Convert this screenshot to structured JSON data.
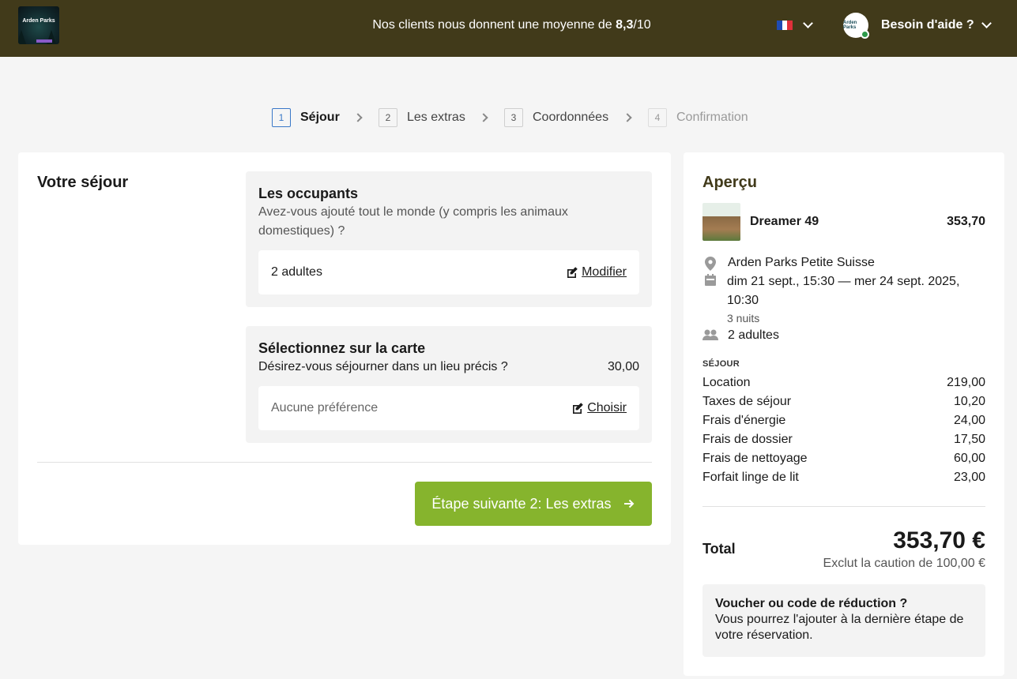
{
  "header": {
    "logo_text": "Arden Parks",
    "rating_prefix": "Nos clients nous donnent une moyenne de ",
    "rating_value": "8,3",
    "rating_suffix": "/10",
    "avatar_text": "Arden Parks",
    "help_label": "Besoin d'aide ?",
    "flag_colors": [
      "#1f4bb4",
      "#ffffff",
      "#e0303a"
    ]
  },
  "steps": [
    {
      "num": "1",
      "label": "Séjour"
    },
    {
      "num": "2",
      "label": "Les extras"
    },
    {
      "num": "3",
      "label": "Coordonnées"
    },
    {
      "num": "4",
      "label": "Confirmation"
    }
  ],
  "main": {
    "title": "Votre séjour",
    "occupants": {
      "title": "Les occupants",
      "desc": "Avez-vous ajouté tout le monde (y compris les animaux domestiques) ?",
      "value": "2 adultes",
      "action": "Modifier"
    },
    "map": {
      "title": "Sélectionnez sur la carte",
      "desc": "Désirez-vous séjourner dans un lieu précis ?",
      "price": "30,00",
      "value": "Aucune préférence",
      "action": "Choisir"
    },
    "next_button": "Étape suivante 2: Les extras"
  },
  "summary": {
    "title": "Aperçu",
    "product": "Dreamer 49",
    "product_price": "353,70",
    "park": "Arden Parks Petite Suisse",
    "dates": "dim 21 sept., 15:30 — mer 24 sept. 2025, 10:30",
    "nights": "3 nuits",
    "guests": "2 adultes",
    "section_label": "SÉJOUR",
    "fees": [
      {
        "label": "Location",
        "value": "219,00"
      },
      {
        "label": "Taxes de séjour",
        "value": "10,20"
      },
      {
        "label": "Frais d'énergie",
        "value": "24,00"
      },
      {
        "label": "Frais de dossier",
        "value": "17,50"
      },
      {
        "label": "Frais de nettoyage",
        "value": "60,00"
      },
      {
        "label": "Forfait linge de lit",
        "value": "23,00"
      }
    ],
    "total_label": "Total",
    "total_value": "353,70 €",
    "deposit_note": "Exclut la caution de 100,00 €",
    "voucher_title": "Voucher ou code de réduction ?",
    "voucher_desc": "Vous pourrez l'ajouter à la dernière étape de votre réservation."
  },
  "colors": {
    "header_bg": "#413a1a",
    "accent_green": "#86b42d",
    "step_active": "#3a78c8"
  }
}
